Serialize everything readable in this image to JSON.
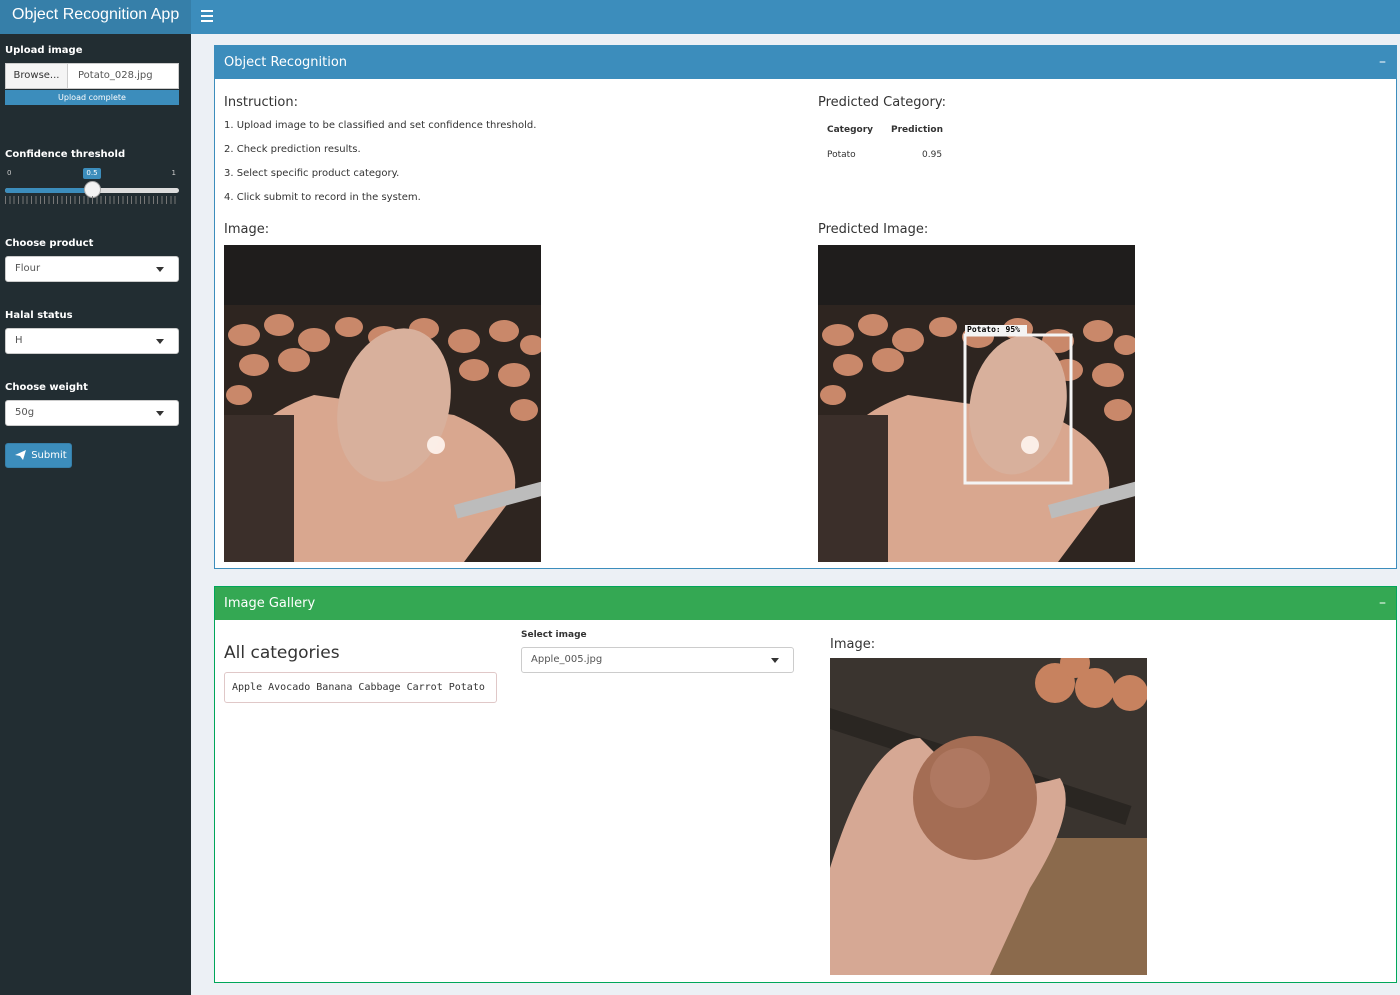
{
  "header": {
    "app_title": "Object Recognition App"
  },
  "sidebar": {
    "upload_label": "Upload image",
    "browse_label": "Browse...",
    "file_name": "Potato_028.jpg",
    "upload_status": "Upload complete",
    "threshold_label": "Confidence threshold",
    "threshold_min": "0",
    "threshold_max": "1",
    "threshold_value": "0.5",
    "threshold_fraction": 0.5,
    "product_label": "Choose product",
    "product_value": "Flour",
    "halal_label": "Halal status",
    "halal_value": "H",
    "weight_label": "Choose weight",
    "weight_value": "50g",
    "submit_label": "Submit"
  },
  "recognition": {
    "title": "Object Recognition",
    "collapse_icon": "minus-icon",
    "instruction_title": "Instruction:",
    "instructions": [
      "1. Upload image to be classified and set confidence threshold.",
      "2. Check prediction results.",
      "3. Select specific product category.",
      "4. Click submit to record in the system."
    ],
    "image_title": "Image:",
    "predicted_category_title": "Predicted Category:",
    "table_headers": [
      "Category",
      "Prediction"
    ],
    "table_rows": [
      {
        "category": "Potato",
        "prediction": "0.95"
      }
    ],
    "predicted_image_title": "Predicted Image:",
    "box_label": "Potato: 95%"
  },
  "gallery": {
    "title": "Image Gallery",
    "categories_title": "All categories",
    "categories_text": "Apple Avocado Banana Cabbage Carrot Potato",
    "select_label": "Select image",
    "select_value": "Apple_005.jpg",
    "image_title": "Image:"
  }
}
